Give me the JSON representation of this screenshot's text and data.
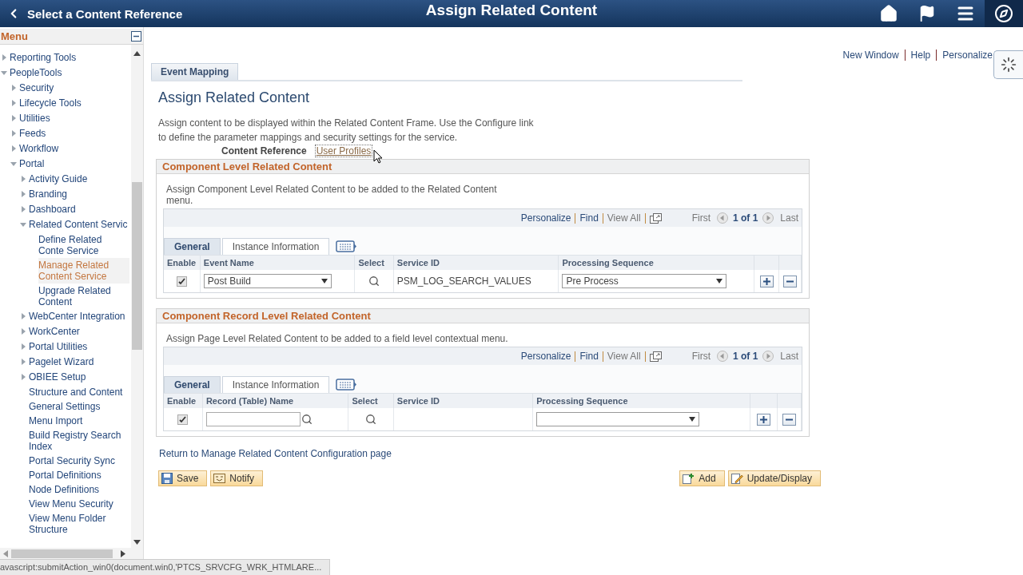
{
  "header": {
    "back_label": "Select a Content Reference",
    "title": "Assign Related Content"
  },
  "menu": {
    "title": "Menu",
    "items": [
      {
        "label": "Reporting Tools",
        "kind": "folder",
        "expanded": false,
        "selected": false
      },
      {
        "label": "PeopleTools",
        "kind": "folder",
        "expanded": true,
        "selected": false,
        "children": [
          {
            "label": "Security",
            "kind": "folder",
            "expanded": false,
            "selected": false
          },
          {
            "label": "Lifecycle Tools",
            "kind": "folder",
            "expanded": false,
            "selected": false
          },
          {
            "label": "Utilities",
            "kind": "folder",
            "expanded": false,
            "selected": false
          },
          {
            "label": "Feeds",
            "kind": "folder",
            "expanded": false,
            "selected": false
          },
          {
            "label": "Workflow",
            "kind": "folder",
            "expanded": false,
            "selected": false
          },
          {
            "label": "Portal",
            "kind": "folder",
            "expanded": true,
            "selected": false,
            "children": [
              {
                "label": "Activity Guide",
                "kind": "folder",
                "expanded": false,
                "selected": false
              },
              {
                "label": "Branding",
                "kind": "folder",
                "expanded": false,
                "selected": false
              },
              {
                "label": "Dashboard",
                "kind": "folder",
                "expanded": false,
                "selected": false
              },
              {
                "label": "Related Content Servic",
                "kind": "folder",
                "expanded": true,
                "selected": false,
                "children": [
                  {
                    "label": "Define Related Conte Service",
                    "kind": "leaf",
                    "selected": false
                  },
                  {
                    "label": "Manage Related Content Service",
                    "kind": "leaf",
                    "selected": true
                  },
                  {
                    "label": "Upgrade Related Content",
                    "kind": "leaf",
                    "selected": false
                  }
                ]
              },
              {
                "label": "WebCenter Integration",
                "kind": "folder",
                "expanded": false,
                "selected": false
              },
              {
                "label": "WorkCenter",
                "kind": "folder",
                "expanded": false,
                "selected": false
              },
              {
                "label": "Portal Utilities",
                "kind": "folder",
                "expanded": false,
                "selected": false
              },
              {
                "label": "Pagelet Wizard",
                "kind": "folder",
                "expanded": false,
                "selected": false
              },
              {
                "label": "OBIEE Setup",
                "kind": "folder",
                "expanded": false,
                "selected": false
              },
              {
                "label": "Structure and Content",
                "kind": "leaf",
                "selected": false
              },
              {
                "label": "General Settings",
                "kind": "leaf",
                "selected": false
              },
              {
                "label": "Menu Import",
                "kind": "leaf",
                "selected": false
              },
              {
                "label": "Build Registry Search Index",
                "kind": "leaf",
                "selected": false
              },
              {
                "label": "Portal Security Sync",
                "kind": "leaf",
                "selected": false
              },
              {
                "label": "Portal Definitions",
                "kind": "leaf",
                "selected": false
              },
              {
                "label": "Node Definitions",
                "kind": "leaf",
                "selected": false
              },
              {
                "label": "View Menu Security",
                "kind": "leaf",
                "selected": false
              },
              {
                "label": "View Menu Folder Structure",
                "kind": "leaf",
                "selected": false
              }
            ]
          }
        ]
      }
    ]
  },
  "top_links": [
    "New Window",
    "Help",
    "Personalize"
  ],
  "page_tabs": [
    {
      "label": "Event Mapping",
      "selected": true
    }
  ],
  "page_title": "Assign Related Content",
  "description": "Assign content to be displayed within the Related Content Frame. Use the Configure link to define the parameter mappings and security settings for the service.",
  "content_reference": {
    "label": "Content Reference",
    "value": "User Profiles"
  },
  "sections": [
    {
      "title": "Component Level Related Content",
      "description": "Assign Component Level Related Content to be added to the Related Content menu.",
      "grid": {
        "nav": {
          "personalize": "Personalize",
          "find": "Find",
          "view_all": "View All",
          "first": "First",
          "count": "1 of 1",
          "last": "Last"
        },
        "tabs": [
          {
            "label": "General",
            "selected": true
          },
          {
            "label": "Instance Information",
            "selected": false
          }
        ],
        "columns": [
          "Enable",
          "Event Name",
          "Select",
          "Service ID",
          "Processing Sequence"
        ],
        "rows": [
          [
            {
              "kind": "checkbox",
              "checked": true
            },
            {
              "kind": "dropdown",
              "value": "Post Build"
            },
            {
              "kind": "lookup"
            },
            {
              "kind": "text",
              "value": "PSM_LOG_SEARCH_VALUES"
            },
            {
              "kind": "dropdown",
              "value": "Pre Process"
            }
          ]
        ]
      }
    },
    {
      "title": "Component Record Level Related Content",
      "description": "Assign Page Level Related Content to be added to a field level contextual menu.",
      "grid": {
        "nav": {
          "personalize": "Personalize",
          "find": "Find",
          "view_all": "View All",
          "first": "First",
          "count": "1 of 1",
          "last": "Last"
        },
        "tabs": [
          {
            "label": "General",
            "selected": true
          },
          {
            "label": "Instance Information",
            "selected": false
          }
        ],
        "columns": [
          "Enable",
          "Record (Table) Name",
          "Select",
          "Service ID",
          "Processing Sequence"
        ],
        "rows": [
          [
            {
              "kind": "checkbox",
              "checked": true
            },
            {
              "kind": "lookup-input"
            },
            {
              "kind": "lookup"
            },
            {
              "kind": "empty"
            },
            {
              "kind": "dropdown"
            }
          ]
        ]
      }
    }
  ],
  "return_link": "Return to Manage Related Content Configuration page",
  "buttons": [
    {
      "label": "Save",
      "kind": "save"
    },
    {
      "label": "Notify",
      "kind": "notify"
    },
    {
      "label": "Add",
      "kind": "add"
    },
    {
      "label": "Update/Display",
      "kind": "update"
    }
  ],
  "status_bar": "avascript:submitAction_win0(document.win0,'PTCS_SRVCFG_WRK_HTMLARE..."
}
